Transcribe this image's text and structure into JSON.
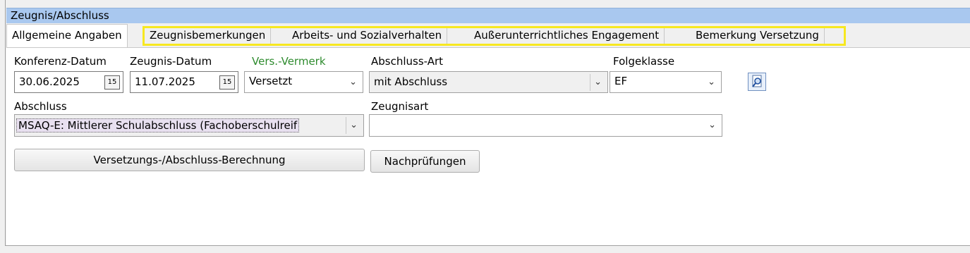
{
  "window": {
    "title": "Zeugnis/Abschluss"
  },
  "tabs": [
    {
      "label": "Allgemeine Angaben",
      "active": true
    },
    {
      "label": "Zeugnisbemerkungen"
    },
    {
      "label": "Arbeits- und Sozialverhalten"
    },
    {
      "label": "Außerunterrichtliches Engagement"
    },
    {
      "label": "Bemerkung Versetzung"
    }
  ],
  "form": {
    "konferenz_datum": {
      "label": "Konferenz-Datum",
      "value": "30.06.2025"
    },
    "zeugnis_datum": {
      "label": "Zeugnis-Datum",
      "value": "11.07.2025"
    },
    "vers_vermerk": {
      "label": "Vers.-Vermerk",
      "value": "Versetzt",
      "label_color": "#2e8b2e"
    },
    "abschluss_art": {
      "label": "Abschluss-Art",
      "value": "mit Abschluss"
    },
    "folgeklasse": {
      "label": "Folgeklasse",
      "value": "EF"
    },
    "abschluss": {
      "label": "Abschluss",
      "value": "MSAQ-E: Mittlerer Schulabschluss (Fachoberschulreif"
    },
    "zeugnisart": {
      "label": "Zeugnisart",
      "value": ""
    }
  },
  "buttons": {
    "berechnung": "Versetzungs-/Abschluss-Berechnung",
    "nachpruefungen": "Nachprüfungen"
  },
  "icons": {
    "calendar": "calendar-icon",
    "dropdown": "chevron-down-icon",
    "lookup": "search-document-icon"
  },
  "colors": {
    "titlebar": "#a9c8ef",
    "tab_highlight": "#f7e820",
    "label_green": "#2e8b2e"
  }
}
